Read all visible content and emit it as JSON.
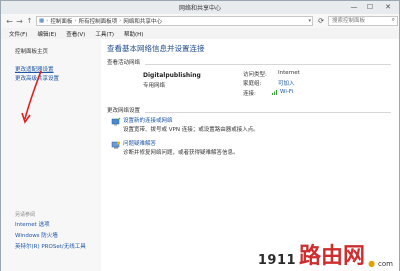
{
  "window": {
    "title": "网络和共享中心",
    "controls": {
      "minimize": "—",
      "maximize": "☐",
      "close": "✕"
    }
  },
  "navbar": {
    "breadcrumb": [
      "控制面板",
      "所有控制面板项",
      "网络和共享中心"
    ],
    "search_placeholder": "搜索控制面板"
  },
  "menubar": {
    "items": [
      "文件(F)",
      "编辑(E)",
      "查看(V)",
      "工具(T)",
      "帮助(H)"
    ]
  },
  "sidebar": {
    "home": "控制面板主页",
    "links": [
      "更改适配器设置",
      "更改高级共享设置"
    ],
    "see_also_title": "另请参阅",
    "see_also": [
      "Internet 选项",
      "Windows 防火墙",
      "英特尔(R) PROSet/无线工具"
    ]
  },
  "main": {
    "heading": "查看基本网络信息并设置连接",
    "active_label": "查看活动网络",
    "network_name": "Digitalpublishing",
    "network_type": "专用网络",
    "access_type_label": "访问类型:",
    "access_type_value": "Internet",
    "homegroup_label": "家庭组:",
    "homegroup_value": "可加入",
    "connections_label": "连接:",
    "connections_value": "Wi-Fi",
    "change_label": "更改网络设置",
    "tasks": [
      {
        "title": "设置新的连接或网络",
        "desc": "设置宽带、拨号或 VPN 连接；或设置路由器或接入点。"
      },
      {
        "title": "问题疑难解答",
        "desc": "诊断并修复网络问题，或者获得疑难解答信息。"
      }
    ]
  },
  "watermark": {
    "number": "1911",
    "text": "路由网",
    "dot": "●",
    "com": "com"
  },
  "colors": {
    "link": "#1d55a8",
    "heading": "#1f4b8b",
    "arrow": "#e02020"
  }
}
